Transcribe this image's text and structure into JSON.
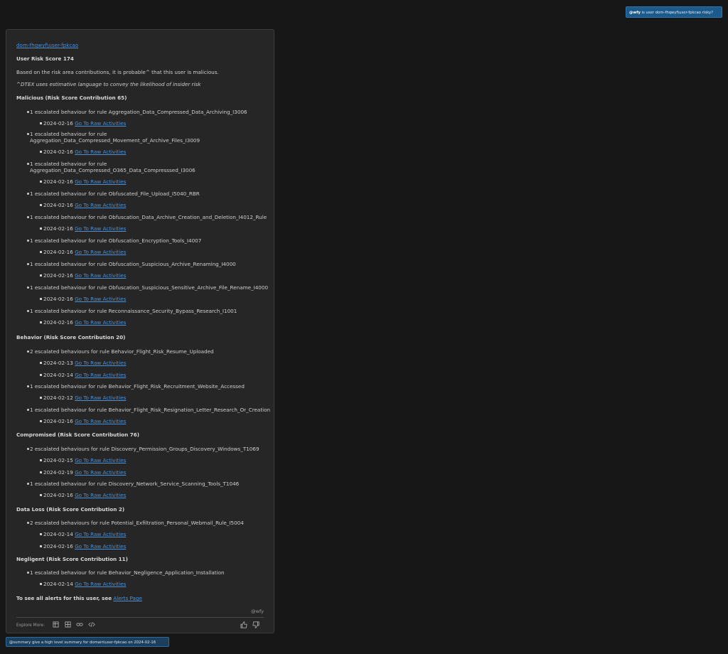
{
  "query": {
    "mention": "@wfy",
    "text": "is user dom-fhqwyf\\user-fpkcao risky?"
  },
  "report": {
    "user_link": "dom-fhqwyf\\user-fpkcao",
    "risk_score": "User Risk Score 174",
    "summary": "Based on the risk area contributions, it is probable^ that this user is malicious.",
    "footnote": "^DTEX uses estimative language to convey the likelihood of insider risk",
    "link_label": "Go To Raw Activities",
    "sections": [
      {
        "title": "Malicious (Risk Score Contribution 65)",
        "rules": [
          {
            "text": "1 escalated behaviour for rule Aggregation_Data_Compressed_Data_Archiving_I3006",
            "dates": [
              "2024-02-16"
            ]
          },
          {
            "text": "1 escalated behaviour for rule Aggregation_Data_Compressed_Movement_of_Archive_Files_I3009",
            "dates": [
              "2024-02-16"
            ]
          },
          {
            "text": "1 escalated behaviour for rule Aggregation_Data_Compressed_O365_Data_Compresssed_I3006",
            "dates": [
              "2024-02-16"
            ]
          },
          {
            "text": "1 escalated behaviour for rule Obfuscated_File_Upload_I5040_RBR",
            "dates": [
              "2024-02-16"
            ]
          },
          {
            "text": "1 escalated behaviour for rule Obfuscation_Data_Archive_Creation_and_Deletion_I4012_Rule",
            "dates": [
              "2024-02-16"
            ]
          },
          {
            "text": "1 escalated behaviour for rule Obfuscation_Encryption_Tools_I4007",
            "dates": [
              "2024-02-16"
            ]
          },
          {
            "text": "1 escalated behaviour for rule Obfuscation_Suspicious_Archive_Renaming_I4000",
            "dates": [
              "2024-02-16"
            ]
          },
          {
            "text": "1 escalated behaviour for rule Obfuscation_Suspicious_Sensitive_Archive_File_Rename_I4000",
            "dates": [
              "2024-02-16"
            ]
          },
          {
            "text": "1 escalated behaviour for rule Reconnaissance_Security_Bypass_Research_I1001",
            "dates": [
              "2024-02-16"
            ]
          }
        ]
      },
      {
        "title": "Behavior (Risk Score Contribution 20)",
        "rules": [
          {
            "text": "2 escalated behaviours for rule Behavior_Flight_Risk_Resume_Uploaded",
            "dates": [
              "2024-02-13",
              "2024-02-14"
            ]
          },
          {
            "text": "1 escalated behaviour for rule Behavior_Flight_Risk_Recruitment_Website_Accessed",
            "dates": [
              "2024-02-12"
            ]
          },
          {
            "text": "1 escalated behaviour for rule Behavior_Flight_Risk_Resignation_Letter_Research_Or_Creation",
            "dates": [
              "2024-02-16"
            ]
          }
        ]
      },
      {
        "title": "Compromised (Risk Score Contribution 76)",
        "rules": [
          {
            "text": "2 escalated behaviours for rule Discovery_Permission_Groups_Discovery_Windows_T1069",
            "dates": [
              "2024-02-15",
              "2024-02-19"
            ]
          },
          {
            "text": "1 escalated behaviour for rule Discovery_Network_Service_Scanning_Tools_T1046",
            "dates": [
              "2024-02-16"
            ]
          }
        ]
      },
      {
        "title": "Data Loss (Risk Score Contribution 2)",
        "rules": [
          {
            "text": "2 escalated behaviours for rule Potential_Exfiltration_Personal_Webmail_Rule_I5004",
            "dates": [
              "2024-02-14",
              "2024-02-16"
            ]
          }
        ]
      },
      {
        "title": "Negligent (Risk Score Contribution 11)",
        "rules": [
          {
            "text": "1 escalated behaviour for rule Behavior_Negligence_Application_Installation",
            "dates": [
              "2024-02-14"
            ]
          }
        ]
      }
    ],
    "alerts_prefix": "To see all alerts for this user, see",
    "alerts_link": "Alerts Page",
    "byline": "@wfy",
    "explore_label": "Explore More:"
  },
  "icons": {
    "explore": [
      "table-icon",
      "grid-icon",
      "link-icon",
      "code-icon"
    ],
    "feedback": [
      "thumbs-up-icon",
      "thumbs-down-icon"
    ]
  },
  "suggestion": "@summary give a high level summary for domain\\user-fpkcao on 2024-02-16",
  "colors": {
    "background": "#171717",
    "card": "#262626",
    "link": "#4a90d9",
    "user_bubble": "#1d5a8c",
    "suggestion_bubble": "#1d3f5e"
  }
}
